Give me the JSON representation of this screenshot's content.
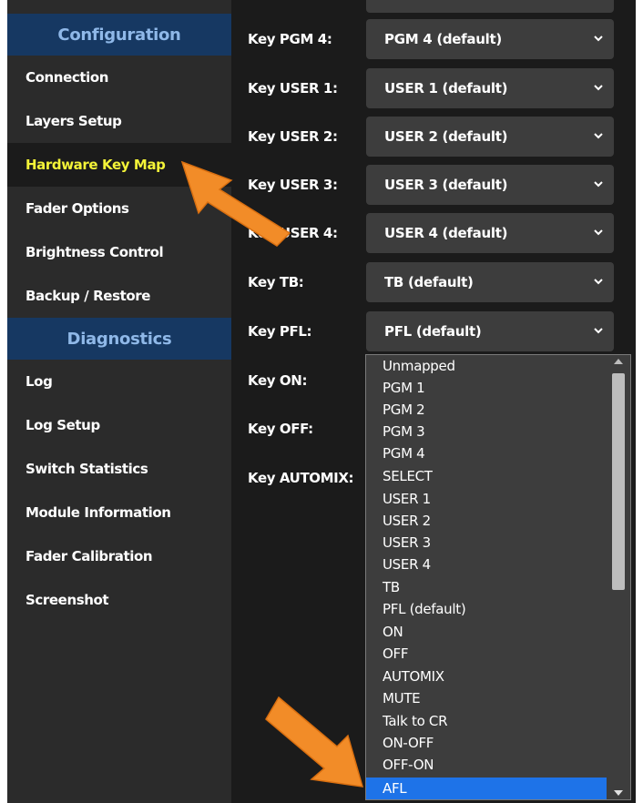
{
  "sidebar": {
    "configuration_header": "Configuration",
    "diagnostics_header": "Diagnostics",
    "config_items": [
      {
        "label": "Connection"
      },
      {
        "label": "Layers Setup"
      },
      {
        "label": "Hardware Key Map"
      },
      {
        "label": "Fader Options"
      },
      {
        "label": "Brightness Control"
      },
      {
        "label": "Backup / Restore"
      }
    ],
    "diagnostics_items": [
      {
        "label": "Log"
      },
      {
        "label": "Log Setup"
      },
      {
        "label": "Switch Statistics"
      },
      {
        "label": "Module Information"
      },
      {
        "label": "Fader Calibration"
      },
      {
        "label": "Screenshot"
      }
    ]
  },
  "key_rows": [
    {
      "label": "Key PGM 4:",
      "value": "PGM 4 (default)"
    },
    {
      "label": "Key USER 1:",
      "value": "USER 1 (default)"
    },
    {
      "label": "Key USER 2:",
      "value": "USER 2 (default)"
    },
    {
      "label": "Key USER 3:",
      "value": "USER 3 (default)"
    },
    {
      "label": "Key USER 4:",
      "value": "USER 4 (default)"
    },
    {
      "label": "Key TB:",
      "value": "TB (default)"
    },
    {
      "label": "Key PFL:",
      "value": "PFL (default)"
    },
    {
      "label": "Key ON:"
    },
    {
      "label": "Key OFF:"
    },
    {
      "label": "Key AUTOMIX:"
    }
  ],
  "dropdown_options": [
    "Unmapped",
    "PGM 1",
    "PGM 2",
    "PGM 3",
    "PGM 4",
    "SELECT",
    "USER 1",
    "USER 2",
    "USER 3",
    "USER 4",
    "TB",
    "PFL (default)",
    "ON",
    "OFF",
    "AUTOMIX",
    "MUTE",
    "Talk to CR",
    "ON-OFF",
    "OFF-ON",
    "AFL"
  ],
  "selected_option": "AFL",
  "colors": {
    "accent_highlight": "#1e73e8",
    "active_nav_text": "#f4f438",
    "section_header_bg": "#163862",
    "annotation_arrow": "#f28c28"
  }
}
